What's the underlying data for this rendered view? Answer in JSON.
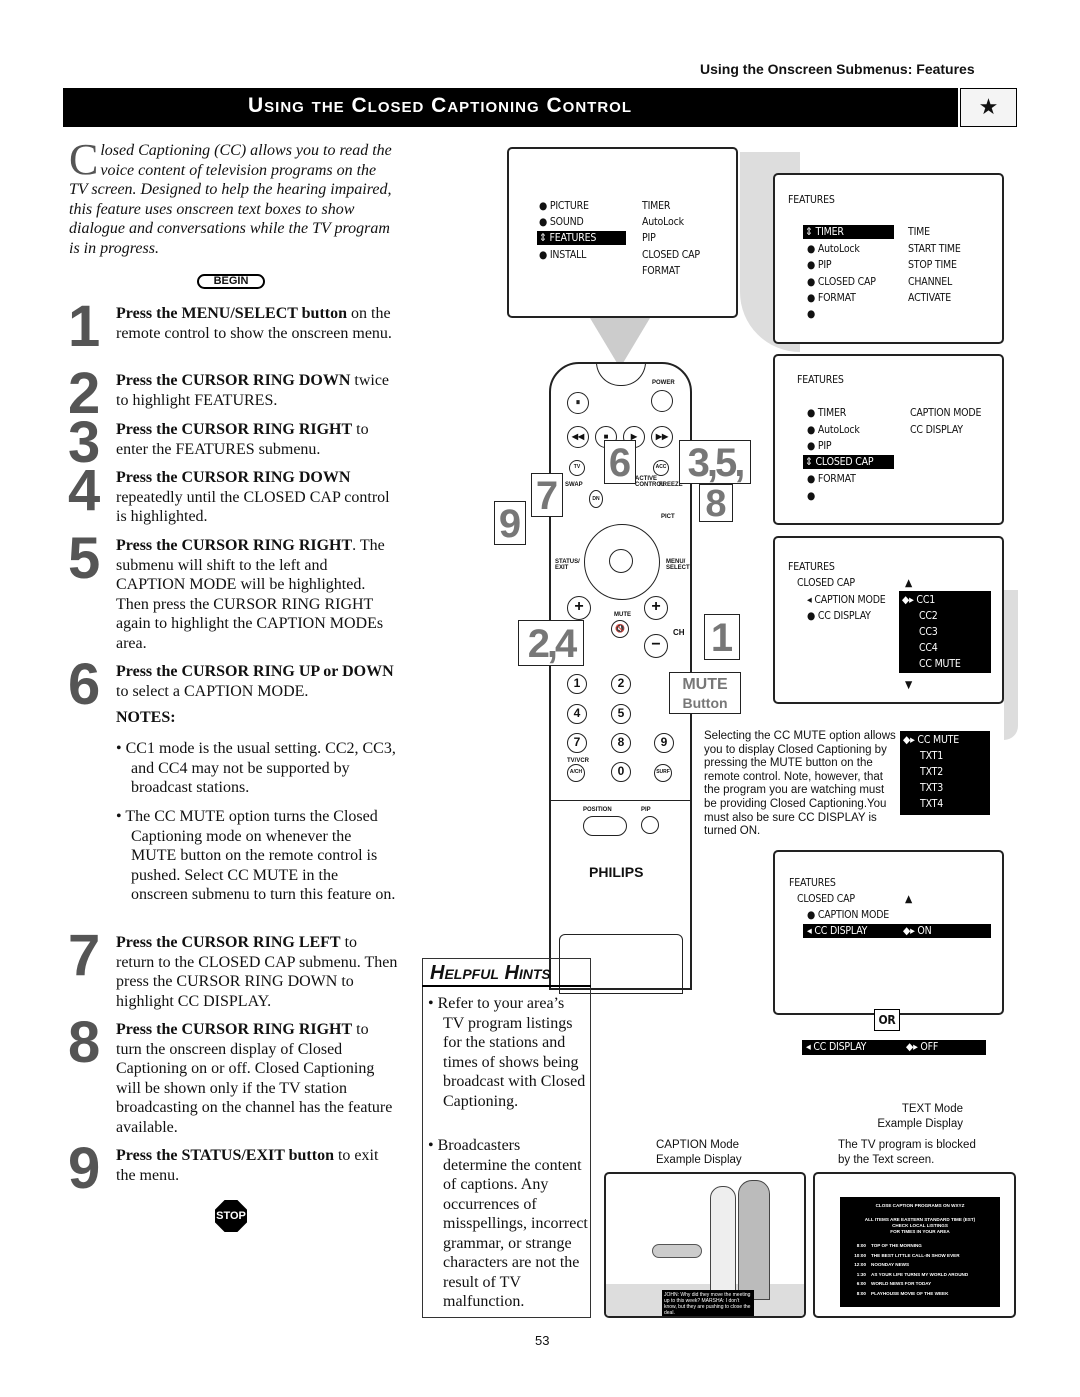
{
  "running_head": "Using the Onscreen Submenus: Features",
  "banner_title": "Using the Closed Captioning Control",
  "banner_icon": "stars-tv-icon",
  "intro": {
    "dropcap": "C",
    "text": "losed Captioning (CC) allows you to read the voice content of television programs on the TV screen. Designed to help the hearing impaired, this feature uses onscreen text boxes to show dialogue and conversations while the TV program is in progress."
  },
  "begin_label": "BEGIN",
  "steps": [
    {
      "num": "1",
      "bold": "Press the MENU/SELECT button",
      "text": " on the remote control to show the onscreen menu."
    },
    {
      "num": "2",
      "bold": "Press the CURSOR RING DOWN",
      "text": " twice to highlight FEATURES."
    },
    {
      "num": "3",
      "bold": "Press the CURSOR RING RIGHT",
      "text": " to enter the FEATURES submenu."
    },
    {
      "num": "4",
      "bold": "Press the CURSOR RING DOWN",
      "text": " repeatedly until the CLOSED CAP control is highlighted."
    },
    {
      "num": "5",
      "bold": "Press the CURSOR RING RIGHT",
      "text": ". The submenu will shift to the left and CAPTION MODE will be highlighted. Then press the CURSOR RING RIGHT again to highlight the CAPTION MODEs area."
    },
    {
      "num": "6",
      "bold": "Press the CURSOR RING UP or DOWN",
      "text": " to select a CAPTION MODE."
    },
    {
      "num": "7",
      "bold": "Press the CURSOR RING LEFT",
      "text": " to return to the CLOSED CAP submenu. Then press the CURSOR RING DOWN to highlight CC DISPLAY."
    },
    {
      "num": "8",
      "bold": "Press the CURSOR RING RIGHT",
      "text": " to turn the onscreen display of Closed Captioning on or off. Closed Captioning will be shown only if the TV station broadcasting on the channel has the feature available."
    },
    {
      "num": "9",
      "bold": "Press the STATUS/EXIT button",
      "text": " to exit the menu."
    }
  ],
  "notes_heading": "NOTES:",
  "notes": [
    "• CC1 mode is the usual setting. CC2, CC3, and CC4 may not be supported by broadcast stations.",
    "• The CC MUTE option turns the Closed Captioning mode on whenever the MUTE button on the remote control is pushed. Select CC MUTE in the onscreen submenu to turn this feature on."
  ],
  "stop_label": "STOP",
  "main_menu": {
    "left": [
      "PICTURE",
      "SOUND",
      "FEATURES",
      "INSTALL"
    ],
    "right": [
      "TIMER",
      "AutoLock",
      "PIP",
      "CLOSED CAP",
      "FORMAT"
    ]
  },
  "screen1": {
    "title": "FEATURES",
    "left": [
      "TIMER",
      "AutoLock",
      "PIP",
      "CLOSED CAP",
      "FORMAT",
      ""
    ],
    "right": [
      "TIME",
      "START TIME",
      "STOP TIME",
      "CHANNEL",
      "ACTIVATE"
    ]
  },
  "screen2": {
    "title": "FEATURES",
    "left": [
      "TIMER",
      "AutoLock",
      "PIP",
      "CLOSED CAP",
      "FORMAT",
      ""
    ],
    "right": [
      "CAPTION MODE",
      "CC DISPLAY"
    ]
  },
  "screen3": {
    "title": "FEATURES",
    "sub": "CLOSED CAP",
    "left": [
      "CAPTION MODE",
      "CC DISPLAY"
    ],
    "modes": [
      "CC1",
      "CC2",
      "CC3",
      "CC4",
      "CC MUTE"
    ]
  },
  "mute_desc": "Selecting the CC MUTE option allows you to display Closed Captioning by pressing the MUTE button on the remote control. Note, however, that the program you are watching must be providing Closed Captioning.You must also be sure CC DISPLAY is turned ON.",
  "mute_modes": [
    "CC MUTE",
    "TXT1",
    "TXT2",
    "TXT3",
    "TXT4"
  ],
  "screen4": {
    "title": "FEATURES",
    "sub": "CLOSED CAP",
    "left": [
      "CAPTION MODE",
      "CC DISPLAY"
    ],
    "on": "ON",
    "or": "OR",
    "off_label": "CC DISPLAY",
    "off": "OFF"
  },
  "remote": {
    "power": "POWER",
    "tv": "TV",
    "acc": "ACC",
    "swap": "SWAP",
    "active_control": "ACTIVE CONTROL",
    "freeze": "FREEZE",
    "dn": "DN",
    "pict": "PICT",
    "status_exit": "STATUS/ EXIT",
    "menu_select": "MENU/ SELECT",
    "mute": "MUTE",
    "ch": "CH",
    "tvvcr": "TV/VCR",
    "ach": "A/CH",
    "surf": "SURF",
    "position": "POSITION",
    "pip": "PIP",
    "brand": "PHILIPS",
    "digits": [
      "1",
      "2",
      "3",
      "4",
      "5",
      "6",
      "7",
      "8",
      "9",
      "0"
    ],
    "callouts": [
      "6",
      "3,5,",
      "7",
      "8",
      "9",
      "2,4",
      "1"
    ],
    "mute_callout": "MUTE",
    "mute_callout_sub": "Button"
  },
  "hints": {
    "title": "Helpful Hints",
    "items": [
      "• Refer to your area’s TV program listings for the stations and times of shows being broadcast with Closed Captioning.",
      "• Broadcasters determine the content of captions. Any occurrences of misspellings, incorrect grammar, or strange characters are not the result of TV malfunction."
    ]
  },
  "caption_example": {
    "label1": "CAPTION Mode",
    "label2": "Example Display",
    "dialogue": "JOHN: Why did they move the meeting up to this week? MARSHA: I don’t know, but they are pushing to close the deal."
  },
  "text_example": {
    "label1": "TEXT Mode",
    "label2": "Example Display",
    "note1": "The TV program is blocked",
    "note2": "by the Text screen.",
    "head": "CLOSE CAPTION PROGRAMS ON WXYZ",
    "sub": [
      "ALL ITEMS ARE EASTERN STANDARD TIME (EST)",
      "CHECK LOCAL LISTINGS",
      "FOR TIMES IN YOUR AREA"
    ],
    "listings": [
      {
        "t": "8:00",
        "p": "TOP OF THE MORNING"
      },
      {
        "t": "10:00",
        "p": "THE BEST LITTLE CALL-IN SHOW EVER"
      },
      {
        "t": "12:00",
        "p": "NOONDAY NEWS"
      },
      {
        "t": "1:30",
        "p": "AS YOUR LIFE TURNS MY WORLD AROUND"
      },
      {
        "t": "6:00",
        "p": "WORLD NEWS FOR TODAY"
      },
      {
        "t": "8:00",
        "p": "PLAYHOUSE MOVIE OF THE WEEK"
      }
    ]
  },
  "page_number": "53"
}
